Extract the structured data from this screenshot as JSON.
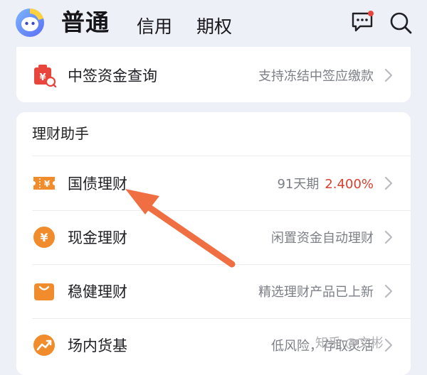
{
  "header": {
    "tabs": [
      {
        "label": "普通",
        "active": true
      },
      {
        "label": "信用",
        "active": false
      },
      {
        "label": "期权",
        "active": false
      }
    ],
    "message_icon": "message-icon",
    "search_icon": "search-icon",
    "logo_icon": "app-logo-icon"
  },
  "top_row": {
    "icon": "lottery-bag-icon",
    "label": "中签资金查询",
    "desc": "支持冻结中签应缴款"
  },
  "section": {
    "title": "理财助手",
    "items": [
      {
        "icon": "ticket-yen-icon",
        "label": "国债理财",
        "desc": "91天期",
        "rate": "2.400%"
      },
      {
        "icon": "yen-coin-icon",
        "label": "现金理财",
        "desc": "闲置资金自动理财"
      },
      {
        "icon": "bag-icon",
        "label": "稳健理财",
        "desc": "精选理财产品已上新"
      },
      {
        "icon": "trend-up-icon",
        "label": "场内货基",
        "desc": "低风险，存取灵活"
      }
    ]
  },
  "watermark": "知乎 @文彬",
  "colors": {
    "accent_orange": "#f08c2c",
    "accent_red": "#e8453c",
    "rate_red": "#d8402f",
    "annotation_arrow": "#ef6f43",
    "background": "#eef0f7"
  }
}
